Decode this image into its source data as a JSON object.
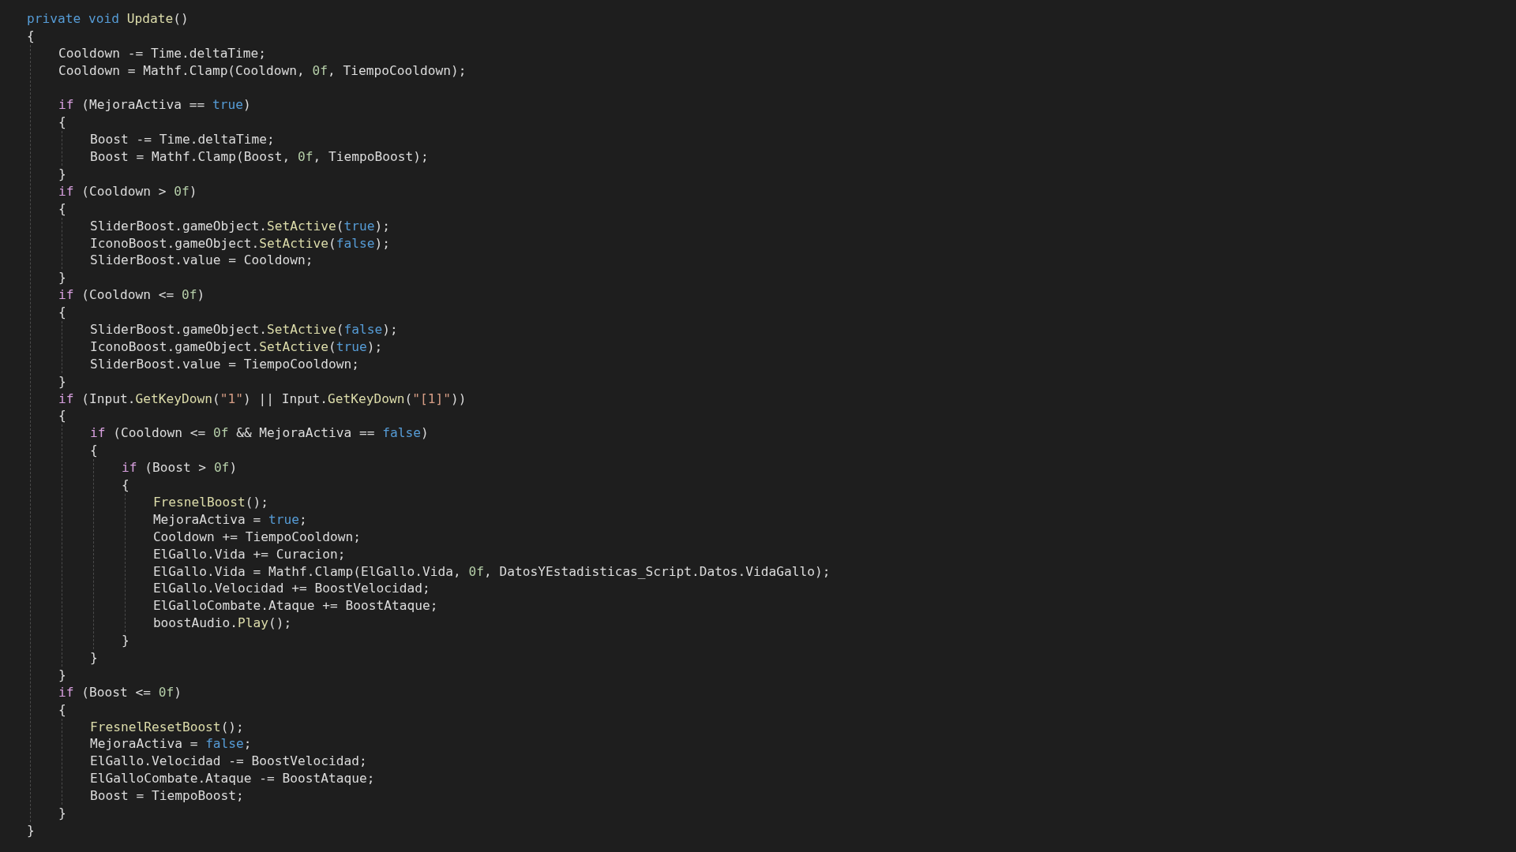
{
  "code": [
    {
      "kind": "line",
      "tokens": [
        {
          "text": "private",
          "kind": "keyword"
        },
        {
          "text": " void",
          "kind": "keyword"
        },
        {
          "text": " Update",
          "kind": "method"
        },
        {
          "text": "()",
          "kind": "plain"
        }
      ]
    },
    {
      "kind": "line",
      "tokens": [
        {
          "text": "{",
          "kind": "plain"
        }
      ]
    },
    {
      "kind": "block",
      "children": [
        {
          "kind": "line",
          "tokens": [
            {
              "text": "Cooldown -= Time.deltaTime;",
              "kind": "plain"
            }
          ]
        },
        {
          "kind": "line",
          "tokens": [
            {
              "text": "Cooldown = Mathf.Clamp(Cooldown, ",
              "kind": "plain"
            },
            {
              "text": "0f",
              "kind": "number"
            },
            {
              "text": ", TiempoCooldown);",
              "kind": "plain"
            }
          ]
        },
        {
          "kind": "blank"
        },
        {
          "kind": "line",
          "tokens": [
            {
              "text": "if",
              "kind": "control"
            },
            {
              "text": " (MejoraActiva == ",
              "kind": "plain"
            },
            {
              "text": "true",
              "kind": "keyword"
            },
            {
              "text": ")",
              "kind": "plain"
            }
          ]
        },
        {
          "kind": "line",
          "tokens": [
            {
              "text": "{",
              "kind": "plain"
            }
          ]
        },
        {
          "kind": "block",
          "children": [
            {
              "kind": "line",
              "tokens": [
                {
                  "text": "Boost -= Time.deltaTime;",
                  "kind": "plain"
                }
              ]
            },
            {
              "kind": "line",
              "tokens": [
                {
                  "text": "Boost = Mathf.Clamp(Boost, ",
                  "kind": "plain"
                },
                {
                  "text": "0f",
                  "kind": "number"
                },
                {
                  "text": ", TiempoBoost);",
                  "kind": "plain"
                }
              ]
            }
          ]
        },
        {
          "kind": "line",
          "tokens": [
            {
              "text": "}",
              "kind": "plain"
            }
          ]
        },
        {
          "kind": "line",
          "tokens": [
            {
              "text": "if",
              "kind": "control"
            },
            {
              "text": " (Cooldown > ",
              "kind": "plain"
            },
            {
              "text": "0f",
              "kind": "number"
            },
            {
              "text": ")",
              "kind": "plain"
            }
          ]
        },
        {
          "kind": "line",
          "tokens": [
            {
              "text": "{",
              "kind": "plain"
            }
          ]
        },
        {
          "kind": "block",
          "children": [
            {
              "kind": "line",
              "tokens": [
                {
                  "text": "SliderBoost.gameObject.",
                  "kind": "plain"
                },
                {
                  "text": "SetActive",
                  "kind": "method"
                },
                {
                  "text": "(",
                  "kind": "plain"
                },
                {
                  "text": "true",
                  "kind": "keyword"
                },
                {
                  "text": ");",
                  "kind": "plain"
                }
              ]
            },
            {
              "kind": "line",
              "tokens": [
                {
                  "text": "IconoBoost.gameObject.",
                  "kind": "plain"
                },
                {
                  "text": "SetActive",
                  "kind": "method"
                },
                {
                  "text": "(",
                  "kind": "plain"
                },
                {
                  "text": "false",
                  "kind": "keyword"
                },
                {
                  "text": ");",
                  "kind": "plain"
                }
              ]
            },
            {
              "kind": "line",
              "tokens": [
                {
                  "text": "SliderBoost.value = Cooldown;",
                  "kind": "plain"
                }
              ]
            }
          ]
        },
        {
          "kind": "line",
          "tokens": [
            {
              "text": "}",
              "kind": "plain"
            }
          ]
        },
        {
          "kind": "line",
          "tokens": [
            {
              "text": "if",
              "kind": "control"
            },
            {
              "text": " (Cooldown <= ",
              "kind": "plain"
            },
            {
              "text": "0f",
              "kind": "number"
            },
            {
              "text": ")",
              "kind": "plain"
            }
          ]
        },
        {
          "kind": "line",
          "tokens": [
            {
              "text": "{",
              "kind": "plain"
            }
          ]
        },
        {
          "kind": "block",
          "children": [
            {
              "kind": "line",
              "tokens": [
                {
                  "text": "SliderBoost.gameObject.",
                  "kind": "plain"
                },
                {
                  "text": "SetActive",
                  "kind": "method"
                },
                {
                  "text": "(",
                  "kind": "plain"
                },
                {
                  "text": "false",
                  "kind": "keyword"
                },
                {
                  "text": ");",
                  "kind": "plain"
                }
              ]
            },
            {
              "kind": "line",
              "tokens": [
                {
                  "text": "IconoBoost.gameObject.",
                  "kind": "plain"
                },
                {
                  "text": "SetActive",
                  "kind": "method"
                },
                {
                  "text": "(",
                  "kind": "plain"
                },
                {
                  "text": "true",
                  "kind": "keyword"
                },
                {
                  "text": ");",
                  "kind": "plain"
                }
              ]
            },
            {
              "kind": "line",
              "tokens": [
                {
                  "text": "SliderBoost.value = TiempoCooldown;",
                  "kind": "plain"
                }
              ]
            }
          ]
        },
        {
          "kind": "line",
          "tokens": [
            {
              "text": "}",
              "kind": "plain"
            }
          ]
        },
        {
          "kind": "line",
          "tokens": [
            {
              "text": "if",
              "kind": "control"
            },
            {
              "text": " (Input.",
              "kind": "plain"
            },
            {
              "text": "GetKeyDown",
              "kind": "method"
            },
            {
              "text": "(",
              "kind": "plain"
            },
            {
              "text": "\"1\"",
              "kind": "string"
            },
            {
              "text": ") || Input.",
              "kind": "plain"
            },
            {
              "text": "GetKeyDown",
              "kind": "method"
            },
            {
              "text": "(",
              "kind": "plain"
            },
            {
              "text": "\"[1]\"",
              "kind": "string"
            },
            {
              "text": "))",
              "kind": "plain"
            }
          ]
        },
        {
          "kind": "line",
          "tokens": [
            {
              "text": "{",
              "kind": "plain"
            }
          ]
        },
        {
          "kind": "block",
          "children": [
            {
              "kind": "line",
              "tokens": [
                {
                  "text": "if",
                  "kind": "control"
                },
                {
                  "text": " (Cooldown <= ",
                  "kind": "plain"
                },
                {
                  "text": "0f",
                  "kind": "number"
                },
                {
                  "text": " && MejoraActiva == ",
                  "kind": "plain"
                },
                {
                  "text": "false",
                  "kind": "keyword"
                },
                {
                  "text": ")",
                  "kind": "plain"
                }
              ]
            },
            {
              "kind": "line",
              "tokens": [
                {
                  "text": "{",
                  "kind": "plain"
                }
              ]
            },
            {
              "kind": "block",
              "children": [
                {
                  "kind": "line",
                  "tokens": [
                    {
                      "text": "if",
                      "kind": "control"
                    },
                    {
                      "text": " (Boost > ",
                      "kind": "plain"
                    },
                    {
                      "text": "0f",
                      "kind": "number"
                    },
                    {
                      "text": ")",
                      "kind": "plain"
                    }
                  ]
                },
                {
                  "kind": "line",
                  "tokens": [
                    {
                      "text": "{",
                      "kind": "plain"
                    }
                  ]
                },
                {
                  "kind": "block",
                  "children": [
                    {
                      "kind": "line",
                      "tokens": [
                        {
                          "text": "FresnelBoost",
                          "kind": "method"
                        },
                        {
                          "text": "();",
                          "kind": "plain"
                        }
                      ]
                    },
                    {
                      "kind": "line",
                      "tokens": [
                        {
                          "text": "MejoraActiva = ",
                          "kind": "plain"
                        },
                        {
                          "text": "true",
                          "kind": "keyword"
                        },
                        {
                          "text": ";",
                          "kind": "plain"
                        }
                      ]
                    },
                    {
                      "kind": "line",
                      "tokens": [
                        {
                          "text": "Cooldown += TiempoCooldown;",
                          "kind": "plain"
                        }
                      ]
                    },
                    {
                      "kind": "line",
                      "tokens": [
                        {
                          "text": "ElGallo.Vida += Curacion;",
                          "kind": "plain"
                        }
                      ]
                    },
                    {
                      "kind": "line",
                      "tokens": [
                        {
                          "text": "ElGallo.Vida = Mathf.Clamp(ElGallo.Vida, ",
                          "kind": "plain"
                        },
                        {
                          "text": "0f",
                          "kind": "number"
                        },
                        {
                          "text": ", DatosYEstadisticas_Script.Datos.VidaGallo);",
                          "kind": "plain"
                        }
                      ]
                    },
                    {
                      "kind": "line",
                      "tokens": [
                        {
                          "text": "ElGallo.Velocidad += BoostVelocidad;",
                          "kind": "plain"
                        }
                      ]
                    },
                    {
                      "kind": "line",
                      "tokens": [
                        {
                          "text": "ElGalloCombate.Ataque += BoostAtaque;",
                          "kind": "plain"
                        }
                      ]
                    },
                    {
                      "kind": "line",
                      "tokens": [
                        {
                          "text": "boostAudio.",
                          "kind": "plain"
                        },
                        {
                          "text": "Play",
                          "kind": "method"
                        },
                        {
                          "text": "();",
                          "kind": "plain"
                        }
                      ]
                    }
                  ]
                },
                {
                  "kind": "line",
                  "tokens": [
                    {
                      "text": "}",
                      "kind": "plain"
                    }
                  ]
                }
              ]
            },
            {
              "kind": "line",
              "tokens": [
                {
                  "text": "}",
                  "kind": "plain"
                }
              ]
            }
          ]
        },
        {
          "kind": "line",
          "tokens": [
            {
              "text": "}",
              "kind": "plain"
            }
          ]
        },
        {
          "kind": "line",
          "tokens": [
            {
              "text": "if",
              "kind": "control"
            },
            {
              "text": " (Boost <= ",
              "kind": "plain"
            },
            {
              "text": "0f",
              "kind": "number"
            },
            {
              "text": ")",
              "kind": "plain"
            }
          ]
        },
        {
          "kind": "line",
          "tokens": [
            {
              "text": "{",
              "kind": "plain"
            }
          ]
        },
        {
          "kind": "block",
          "children": [
            {
              "kind": "line",
              "tokens": [
                {
                  "text": "FresnelResetBoost",
                  "kind": "method"
                },
                {
                  "text": "();",
                  "kind": "plain"
                }
              ]
            },
            {
              "kind": "line",
              "tokens": [
                {
                  "text": "MejoraActiva = ",
                  "kind": "plain"
                },
                {
                  "text": "false",
                  "kind": "keyword"
                },
                {
                  "text": ";",
                  "kind": "plain"
                }
              ]
            },
            {
              "kind": "line",
              "tokens": [
                {
                  "text": "ElGallo.Velocidad -= BoostVelocidad;",
                  "kind": "plain"
                }
              ]
            },
            {
              "kind": "line",
              "tokens": [
                {
                  "text": "ElGalloCombate.Ataque -= BoostAtaque;",
                  "kind": "plain"
                }
              ]
            },
            {
              "kind": "line",
              "tokens": [
                {
                  "text": "Boost = TiempoBoost;",
                  "kind": "plain"
                }
              ]
            }
          ]
        },
        {
          "kind": "line",
          "tokens": [
            {
              "text": "}",
              "kind": "plain"
            }
          ]
        }
      ]
    },
    {
      "kind": "line",
      "tokens": [
        {
          "text": "}",
          "kind": "plain"
        }
      ]
    }
  ]
}
